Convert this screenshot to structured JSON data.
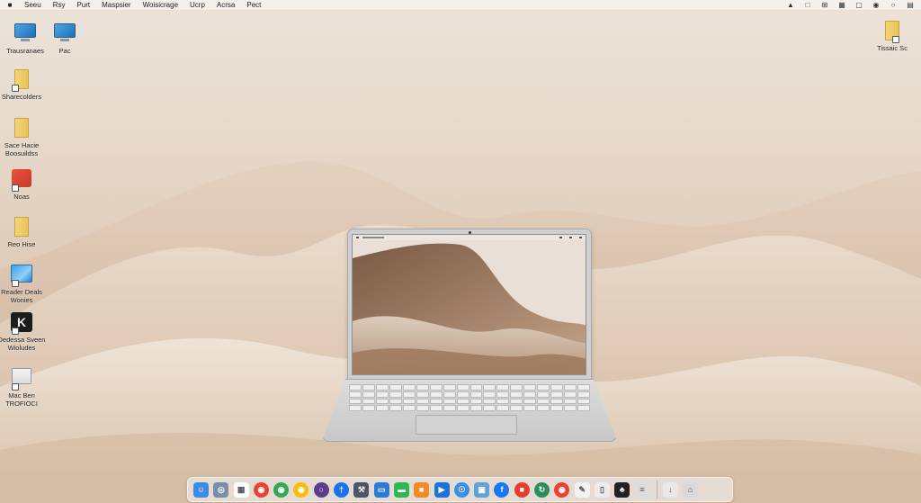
{
  "menubar": {
    "apple_icon": "apple-logo-icon",
    "menus": [
      "Seeu",
      "Rsy",
      "Purt",
      "Maspsier",
      "Woisicrage",
      "Ucrp",
      "Acrsa",
      "Pect"
    ],
    "status_icons": [
      "eject-icon",
      "window-icon",
      "grid-icon",
      "calendar-icon",
      "video-icon",
      "sound-icon",
      "search-icon",
      "control-center-icon"
    ]
  },
  "desktop": {
    "icons": [
      {
        "id": "trash",
        "label": "Trausranaes",
        "icon": "monitor-icon"
      },
      {
        "id": "pac",
        "label": "Pac",
        "icon": "monitor-icon"
      },
      {
        "id": "shared-folder",
        "label": "Sharecolders",
        "icon": "folder-alias-icon"
      },
      {
        "id": "sace-folder",
        "label": "Sace Hacie\nBoosuildss",
        "icon": "folder-icon"
      },
      {
        "id": "notes",
        "label": "Noas",
        "icon": "app-red-icon"
      },
      {
        "id": "re-folder",
        "label": "Reo Hise",
        "icon": "folder-icon"
      },
      {
        "id": "reader",
        "label": "Reader Deals\nWonies",
        "icon": "photo-app-icon"
      },
      {
        "id": "dedessa",
        "label": "Dedessa Sveen\nWioludes",
        "icon": "dark-app-icon"
      },
      {
        "id": "mac",
        "label": "Mac Ben\nTROFIOCI",
        "icon": "document-icon"
      },
      {
        "id": "topright",
        "label": "Tissaic Sc",
        "icon": "folder-alias-icon"
      }
    ]
  },
  "dock": {
    "apps": [
      {
        "name": "finder",
        "icon": "finder-icon",
        "color": "#3c8ce0"
      },
      {
        "name": "launchpad",
        "icon": "launchpad-icon",
        "color": "#7b8ea8"
      },
      {
        "name": "calendar",
        "icon": "calendar-icon",
        "color": "#ffffff"
      },
      {
        "name": "chrome-1",
        "icon": "chrome-icon",
        "color": "#e94235"
      },
      {
        "name": "chrome-2",
        "icon": "chrome-icon",
        "color": "#34a853"
      },
      {
        "name": "chrome-3",
        "icon": "chrome-icon",
        "color": "#fbbc05"
      },
      {
        "name": "tor",
        "icon": "tor-icon",
        "color": "#5b3f8c"
      },
      {
        "name": "pin",
        "icon": "pin-icon",
        "color": "#1a73e8"
      },
      {
        "name": "tools",
        "icon": "tools-icon",
        "color": "#4a5568"
      },
      {
        "name": "keynote",
        "icon": "keynote-icon",
        "color": "#2e7bd6"
      },
      {
        "name": "messages",
        "icon": "messages-icon",
        "color": "#2fb84f"
      },
      {
        "name": "pages",
        "icon": "pages-icon",
        "color": "#f28b28"
      },
      {
        "name": "media",
        "icon": "play-icon",
        "color": "#1d74d8"
      },
      {
        "name": "safari",
        "icon": "safari-icon",
        "color": "#3a8fe0"
      },
      {
        "name": "preview",
        "icon": "preview-icon",
        "color": "#5fa3d9"
      },
      {
        "name": "facebook",
        "icon": "facebook-icon",
        "color": "#1877f2"
      },
      {
        "name": "stop",
        "icon": "stop-icon",
        "color": "#e63d2c"
      },
      {
        "name": "sync",
        "icon": "sync-icon",
        "color": "#2c8e5a"
      },
      {
        "name": "chrome-4",
        "icon": "chrome-icon",
        "color": "#e94235"
      },
      {
        "name": "textedit",
        "icon": "textedit-icon",
        "color": "#f2f2f2"
      },
      {
        "name": "docs",
        "icon": "doc-icon",
        "color": "#ececec"
      },
      {
        "name": "tux",
        "icon": "tux-icon",
        "color": "#222222"
      },
      {
        "name": "script",
        "icon": "script-icon",
        "color": "#dddddd"
      },
      {
        "name": "downloads",
        "icon": "downloads-icon",
        "color": "#e8e8e8"
      },
      {
        "name": "trash",
        "icon": "trash-icon",
        "color": "#d9d9d9"
      }
    ]
  }
}
